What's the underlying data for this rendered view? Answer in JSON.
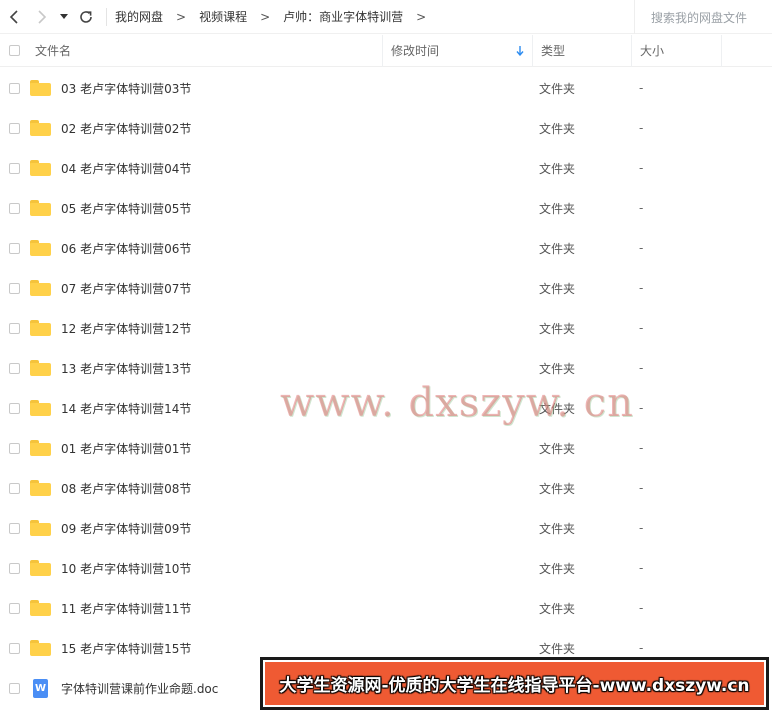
{
  "toolbar": {
    "back_icon": "chevron-left-icon",
    "forward_icon": "chevron-right-icon",
    "dropdown_icon": "caret-down-icon",
    "refresh_icon": "refresh-icon",
    "breadcrumb": [
      "我的网盘",
      "视频课程",
      "卢帅：商业字体特训营"
    ],
    "search_placeholder": "搜索我的网盘文件"
  },
  "header": {
    "name": "文件名",
    "modified": "修改时间",
    "type": "类型",
    "size": "大小",
    "sort_icon": "arrow-down-icon",
    "sort_color": "#2d8cf0"
  },
  "files": [
    {
      "name": "03 老卢字体特训营03节",
      "type": "文件夹",
      "size": "-",
      "icon": "folder-icon"
    },
    {
      "name": "02 老卢字体特训营02节",
      "type": "文件夹",
      "size": "-",
      "icon": "folder-icon"
    },
    {
      "name": "04 老卢字体特训营04节",
      "type": "文件夹",
      "size": "-",
      "icon": "folder-icon"
    },
    {
      "name": "05 老卢字体特训营05节",
      "type": "文件夹",
      "size": "-",
      "icon": "folder-icon"
    },
    {
      "name": "06 老卢字体特训营06节",
      "type": "文件夹",
      "size": "-",
      "icon": "folder-icon"
    },
    {
      "name": "07 老卢字体特训营07节",
      "type": "文件夹",
      "size": "-",
      "icon": "folder-icon"
    },
    {
      "name": "12 老卢字体特训营12节",
      "type": "文件夹",
      "size": "-",
      "icon": "folder-icon"
    },
    {
      "name": "13 老卢字体特训营13节",
      "type": "文件夹",
      "size": "-",
      "icon": "folder-icon"
    },
    {
      "name": "14 老卢字体特训营14节",
      "type": "文件夹",
      "size": "-",
      "icon": "folder-icon"
    },
    {
      "name": "01 老卢字体特训营01节",
      "type": "文件夹",
      "size": "-",
      "icon": "folder-icon"
    },
    {
      "name": "08 老卢字体特训营08节",
      "type": "文件夹",
      "size": "-",
      "icon": "folder-icon"
    },
    {
      "name": "09 老卢字体特训营09节",
      "type": "文件夹",
      "size": "-",
      "icon": "folder-icon"
    },
    {
      "name": "10 老卢字体特训营10节",
      "type": "文件夹",
      "size": "-",
      "icon": "folder-icon"
    },
    {
      "name": "11 老卢字体特训营11节",
      "type": "文件夹",
      "size": "-",
      "icon": "folder-icon"
    },
    {
      "name": "15 老卢字体特训营15节",
      "type": "文件夹",
      "size": "-",
      "icon": "folder-icon"
    },
    {
      "name": "字体特训营课前作业命题.doc",
      "type": "",
      "size": "",
      "icon": "word-doc-icon"
    }
  ],
  "watermark": "www. dxszyw. cn",
  "banner": "大学生资源网-优质的大学生在线指导平台-www.dxszyw.cn",
  "colors": {
    "folder": "#ffd14a",
    "doc": "#4a8ef5",
    "banner_bg": "#ef5a33"
  }
}
